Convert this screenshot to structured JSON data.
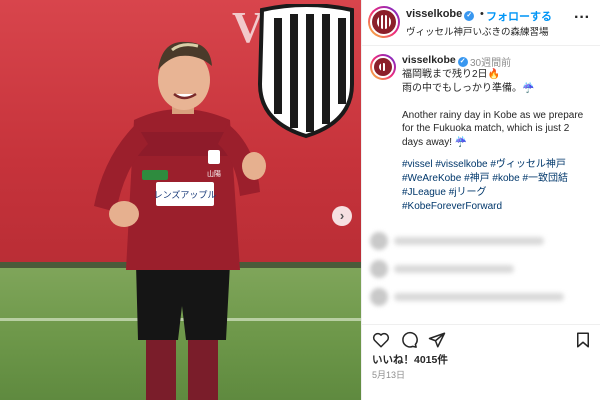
{
  "photo": {
    "banner_text": "VIS",
    "shirt_sponsor": "レンズアップル",
    "shirt_chest": "山陽"
  },
  "header": {
    "username": "visselkobe",
    "separator": "•",
    "follow_label": "フォローする",
    "location": "ヴィッセル神戸いぶきの森練習場"
  },
  "caption": {
    "username": "visselkobe",
    "time": "30週間前",
    "lines": [
      "福岡戦まで残り2日🔥",
      "雨の中でもしっかり準備。☔",
      "",
      "Another rainy day in Kobe as we prepare",
      "for the Fukuoka match, which is just 2",
      "days away! ☔"
    ],
    "hashtag_lines": [
      "#vissel #visselkobe #ヴィッセル神戸",
      "#WeAreKobe #神戸 #kobe #一致団結",
      "#JLeague #jリーグ",
      "#KobeForeverForward"
    ]
  },
  "engagement": {
    "likes": "いいね！4015件",
    "date": "5月13日"
  },
  "icons": {
    "verified": "verified-badge-icon",
    "more": "more-options-icon",
    "like": "heart-icon",
    "comment": "comment-icon",
    "share": "share-icon",
    "save": "bookmark-icon",
    "next": "chevron-right-icon"
  },
  "colors": {
    "follow_blue": "#0095f6",
    "hashtag_blue": "#00376b",
    "club_red": "#8c1f2a",
    "banner_red": "#c6333b"
  }
}
